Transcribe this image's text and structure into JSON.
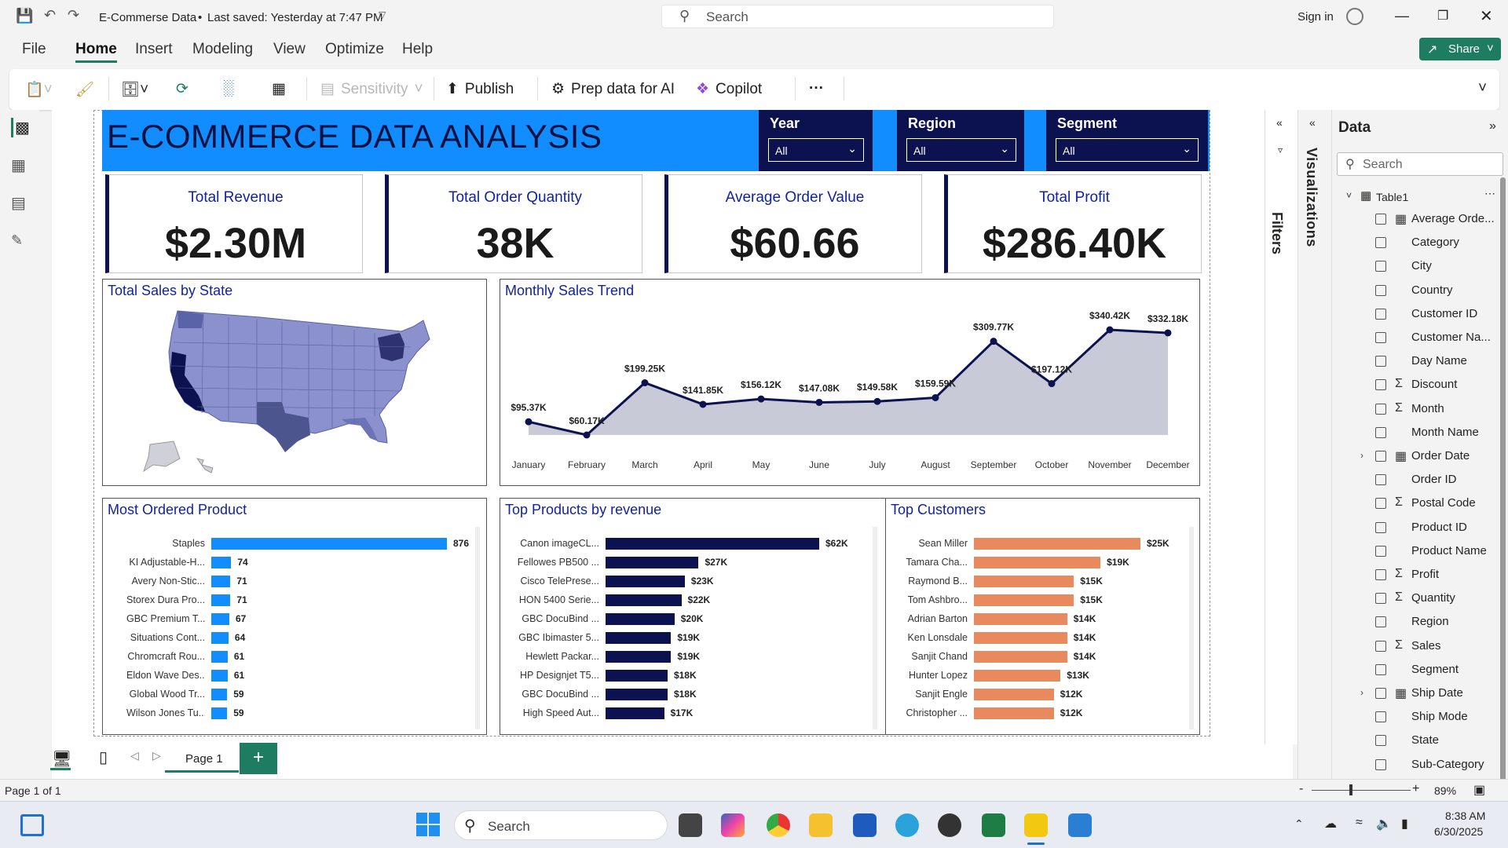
{
  "window": {
    "title": "E-Commerse Data",
    "saved": "Last saved: Yesterday at 7:47 PM",
    "search_placeholder": "Search",
    "sign_in": "Sign in",
    "share": "Share"
  },
  "menu": [
    "File",
    "Home",
    "Insert",
    "Modeling",
    "View",
    "Optimize",
    "Help"
  ],
  "ribbon": {
    "sensitivity": "Sensitivity",
    "publish": "Publish",
    "prep": "Prep data for AI",
    "copilot": "Copilot",
    "more": "···"
  },
  "report": {
    "title": "E-COMMERCE DATA ANALYSIS",
    "slicers": [
      {
        "label": "Year",
        "value": "All"
      },
      {
        "label": "Region",
        "value": "All"
      },
      {
        "label": "Segment",
        "value": "All"
      }
    ],
    "cards": [
      {
        "title": "Total Revenue",
        "value": "$2.30M"
      },
      {
        "title": "Total Order Quantity",
        "value": "38K"
      },
      {
        "title": "Average Order Value",
        "value": "$60.66"
      },
      {
        "title": "Total Profit",
        "value": "$286.40K"
      }
    ],
    "map_title": "Total Sales by State",
    "trend_title": "Monthly Sales Trend",
    "products_title": "Most Ordered Product",
    "revenue_title": "Top Products by revenue",
    "customers_title": "Top Customers"
  },
  "chart_data": [
    {
      "type": "area",
      "title": "Monthly Sales Trend",
      "categories": [
        "January",
        "February",
        "March",
        "April",
        "May",
        "June",
        "July",
        "August",
        "September",
        "October",
        "November",
        "December"
      ],
      "values": [
        95370,
        60170,
        199250,
        141850,
        156120,
        147080,
        149580,
        159590,
        309770,
        197120,
        340420,
        332180
      ],
      "data_labels": [
        "$95.37K",
        "$60.17K",
        "$199.25K",
        "$141.85K",
        "$156.12K",
        "$147.08K",
        "$149.58K",
        "$159.59K",
        "$309.77K",
        "$197.12K",
        "$340.42K",
        "$332.18K"
      ],
      "color": "#0c1150",
      "fill": "#c9cad8"
    },
    {
      "type": "bar",
      "title": "Most Ordered Product",
      "categories": [
        "Staples",
        "KI Adjustable-H...",
        "Avery Non-Stic...",
        "Storex Dura Pro...",
        "GBC Premium T...",
        "Situations Cont...",
        "Chromcraft Rou...",
        "Eldon Wave Des...",
        "Global Wood Tr...",
        "Wilson Jones Tu..."
      ],
      "values": [
        876,
        74,
        71,
        71,
        67,
        64,
        61,
        61,
        59,
        59
      ],
      "data_labels": [
        "876",
        "74",
        "71",
        "71",
        "67",
        "64",
        "61",
        "61",
        "59",
        "59"
      ],
      "color": "#118dff"
    },
    {
      "type": "bar",
      "title": "Top Products by revenue",
      "categories": [
        "Canon imageCL...",
        "Fellowes PB500 ...",
        "Cisco TelePrese...",
        "HON 5400 Serie...",
        "GBC DocuBind ...",
        "GBC Ibimaster 5...",
        "Hewlett Packar...",
        "HP Designjet T5...",
        "GBC DocuBind ...",
        "High Speed Aut..."
      ],
      "values": [
        62,
        27,
        23,
        22,
        20,
        19,
        19,
        18,
        18,
        17
      ],
      "data_labels": [
        "$62K",
        "$27K",
        "$23K",
        "$22K",
        "$20K",
        "$19K",
        "$19K",
        "$18K",
        "$18K",
        "$17K"
      ],
      "color": "#0c1150"
    },
    {
      "type": "bar",
      "title": "Top Customers",
      "categories": [
        "Sean Miller",
        "Tamara Cha...",
        "Raymond B...",
        "Tom Ashbro...",
        "Adrian Barton",
        "Ken Lonsdale",
        "Sanjit Chand",
        "Hunter Lopez",
        "Sanjit Engle",
        "Christopher ..."
      ],
      "values": [
        25,
        19,
        15,
        15,
        14,
        14,
        14,
        13,
        12,
        12
      ],
      "data_labels": [
        "$25K",
        "$19K",
        "$15K",
        "$15K",
        "$14K",
        "$14K",
        "$14K",
        "$13K",
        "$12K",
        "$12K"
      ],
      "color": "#e8895e"
    }
  ],
  "panes": {
    "filters": "Filters",
    "visualizations": "Visualizations",
    "data_title": "Data",
    "data_search": "Search",
    "table": "Table1",
    "fields": [
      {
        "name": "Average Orde...",
        "kind": "calc"
      },
      {
        "name": "Category",
        "kind": "text"
      },
      {
        "name": "City",
        "kind": "text"
      },
      {
        "name": "Country",
        "kind": "text"
      },
      {
        "name": "Customer ID",
        "kind": "text"
      },
      {
        "name": "Customer Na...",
        "kind": "text"
      },
      {
        "name": "Day Name",
        "kind": "text"
      },
      {
        "name": "Discount",
        "kind": "sum"
      },
      {
        "name": "Month",
        "kind": "sum"
      },
      {
        "name": "Month Name",
        "kind": "text"
      },
      {
        "name": "Order Date",
        "kind": "date"
      },
      {
        "name": "Order ID",
        "kind": "text"
      },
      {
        "name": "Postal Code",
        "kind": "sum"
      },
      {
        "name": "Product ID",
        "kind": "text"
      },
      {
        "name": "Product Name",
        "kind": "text"
      },
      {
        "name": "Profit",
        "kind": "sum"
      },
      {
        "name": "Quantity",
        "kind": "sum"
      },
      {
        "name": "Region",
        "kind": "text"
      },
      {
        "name": "Sales",
        "kind": "sum"
      },
      {
        "name": "Segment",
        "kind": "text"
      },
      {
        "name": "Ship Date",
        "kind": "date"
      },
      {
        "name": "Ship Mode",
        "kind": "text"
      },
      {
        "name": "State",
        "kind": "text"
      },
      {
        "name": "Sub-Category",
        "kind": "text"
      }
    ]
  },
  "pages": {
    "page1": "Page 1",
    "add": "+"
  },
  "status": {
    "page": "Page 1 of 1",
    "zoom": "89%",
    "zoom_minus": "-",
    "zoom_plus": "+"
  },
  "taskbar": {
    "search": "Search",
    "time": "8:38 AM",
    "date": "6/30/2025"
  }
}
